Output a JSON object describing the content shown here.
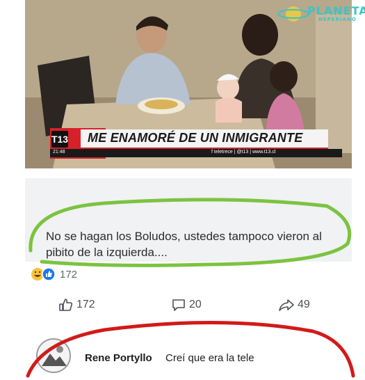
{
  "watermark": {
    "title": "PLANETA",
    "subtitle": "NEPERIANO"
  },
  "tv": {
    "logo": "T13",
    "headline": "ME ENAMORÉ DE UN INMIGRANTE",
    "time": "21:48",
    "social": "f teletrece  |  @t13  |  www.t13.cl"
  },
  "comment": {
    "text": "No se hagan los Boludos, ustedes tampoco vieron al pibito de la izquierda...."
  },
  "reactions": {
    "count": "172"
  },
  "actions": {
    "like_count": "172",
    "comment_count": "20",
    "share_count": "49"
  },
  "reply": {
    "name": "Rene Portyllo",
    "text": "Creí que era la tele"
  },
  "colors": {
    "highlight_green": "#7cc340",
    "annotation_red": "#d21a1a",
    "tv_red": "#d8202a"
  }
}
